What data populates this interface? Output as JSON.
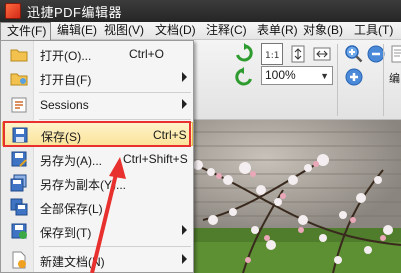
{
  "app": {
    "title": "迅捷PDF编辑器"
  },
  "menubar": {
    "items": [
      {
        "label": "文件(F)"
      },
      {
        "label": "编辑(E)"
      },
      {
        "label": "视图(V)"
      },
      {
        "label": "文档(D)"
      },
      {
        "label": "注释(C)"
      },
      {
        "label": "表单(R)"
      },
      {
        "label": "对象(B)"
      },
      {
        "label": "工具(T)"
      }
    ]
  },
  "file_menu": {
    "items": [
      {
        "label": "打开(O)...",
        "shortcut": "Ctrl+O",
        "icon": "open-folder-icon"
      },
      {
        "label": "打开自(F)",
        "icon": "open-from-icon",
        "submenu": true
      },
      {
        "label": "Sessions",
        "icon": "sessions-icon",
        "submenu": true
      },
      {
        "label": "保存(S)",
        "shortcut": "Ctrl+S",
        "icon": "save-icon",
        "highlighted": true
      },
      {
        "label": "另存为(A)...",
        "shortcut": "Ctrl+Shift+S",
        "icon": "save-as-icon"
      },
      {
        "label": "另存为副本(Y)...",
        "icon": "save-copy-icon"
      },
      {
        "label": "全部保存(L)",
        "icon": "save-all-icon"
      },
      {
        "label": "保存到(T)",
        "icon": "save-to-icon",
        "submenu": true
      },
      {
        "label": "新建文档(N)",
        "icon": "new-document-icon",
        "submenu": true
      }
    ]
  },
  "toolbar": {
    "zoom_value": "100%",
    "edit_label": "编"
  },
  "colors": {
    "highlight_bg": "#fbe39a",
    "highlight_border": "#e7b94a",
    "annotation_red": "#e8312f"
  }
}
